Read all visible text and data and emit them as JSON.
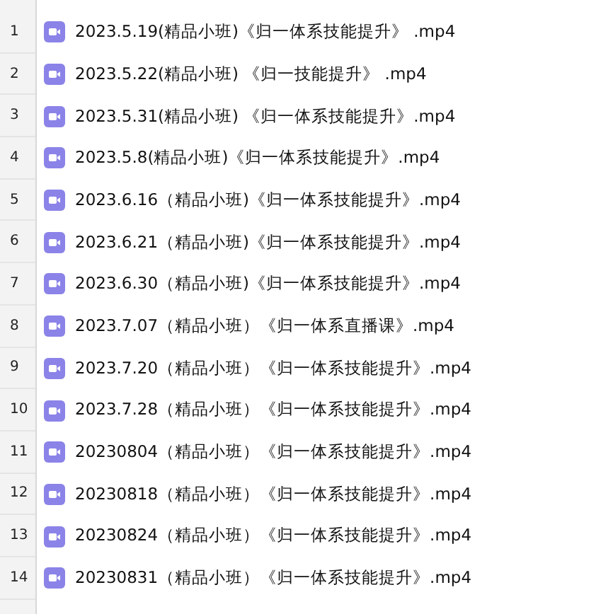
{
  "rows": [
    {
      "number": "1",
      "name": "2023.5.19(精品小班)《归一体系技能提升》 .mp4"
    },
    {
      "number": "2",
      "name": "2023.5.22(精品小班) 《归一技能提升》 .mp4"
    },
    {
      "number": "3",
      "name": "2023.5.31(精品小班) 《归一体系技能提升》.mp4"
    },
    {
      "number": "4",
      "name": "2023.5.8(精品小班)《归一体系技能提升》.mp4"
    },
    {
      "number": "5",
      "name": "2023.6.16（精品小班)《归一体系技能提升》.mp4"
    },
    {
      "number": "6",
      "name": "2023.6.21（精品小班)《归一体系技能提升》.mp4"
    },
    {
      "number": "7",
      "name": "2023.6.30（精品小班)《归一体系技能提升》.mp4"
    },
    {
      "number": "8",
      "name": "2023.7.07（精品小班）《归一体系直播课》.mp4"
    },
    {
      "number": "9",
      "name": "2023.7.20（精品小班）《归一体系技能提升》.mp4"
    },
    {
      "number": "10",
      "name": "2023.7.28（精品小班）《归一体系技能提升》.mp4"
    },
    {
      "number": "11",
      "name": "20230804（精品小班）《归一体系技能提升》.mp4"
    },
    {
      "number": "12",
      "name": "20230818（精品小班）《归一体系技能提升》.mp4"
    },
    {
      "number": "13",
      "name": "20230824（精品小班）《归一体系技能提升》.mp4"
    },
    {
      "number": "14",
      "name": "20230831（精品小班）《归一体系技能提升》.mp4"
    }
  ]
}
